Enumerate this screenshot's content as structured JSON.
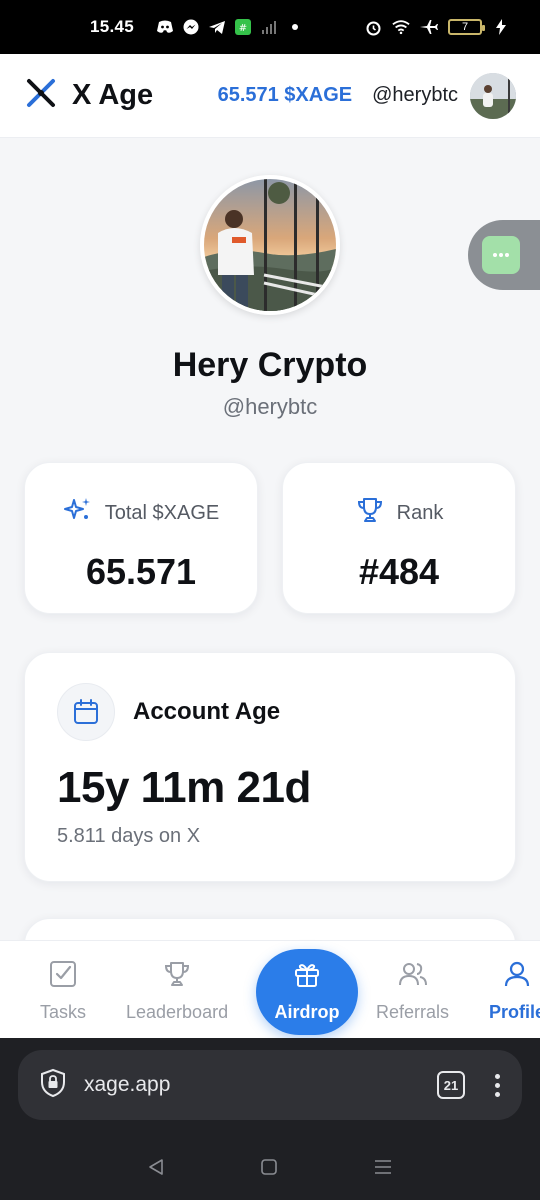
{
  "status_bar": {
    "time": "15.45",
    "battery": "7"
  },
  "header": {
    "brand": "X Age",
    "balance": "65.571 $XAGE",
    "handle": "@herybtc"
  },
  "profile": {
    "name": "Hery Crypto",
    "handle": "@herybtc"
  },
  "stats": [
    {
      "label": "Total $XAGE",
      "value": "65.571",
      "icon": "sparkles-icon"
    },
    {
      "label": "Rank",
      "value": "#484",
      "icon": "trophy-icon"
    }
  ],
  "account_age": {
    "title": "Account Age",
    "value": "15y 11m 21d",
    "days": "5.811 days on X",
    "icon": "calendar-icon"
  },
  "nav": {
    "tasks": "Tasks",
    "leaderboard": "Leaderboard",
    "airdrop": "Airdrop",
    "referrals": "Referrals",
    "profile": "Profile"
  },
  "browser": {
    "url": "xage.app",
    "tabs": "21"
  },
  "colors": {
    "accent": "#2b7de9",
    "brand_blue": "#2b6fd8",
    "text_dark": "#0f1115",
    "muted": "#6b7079"
  }
}
